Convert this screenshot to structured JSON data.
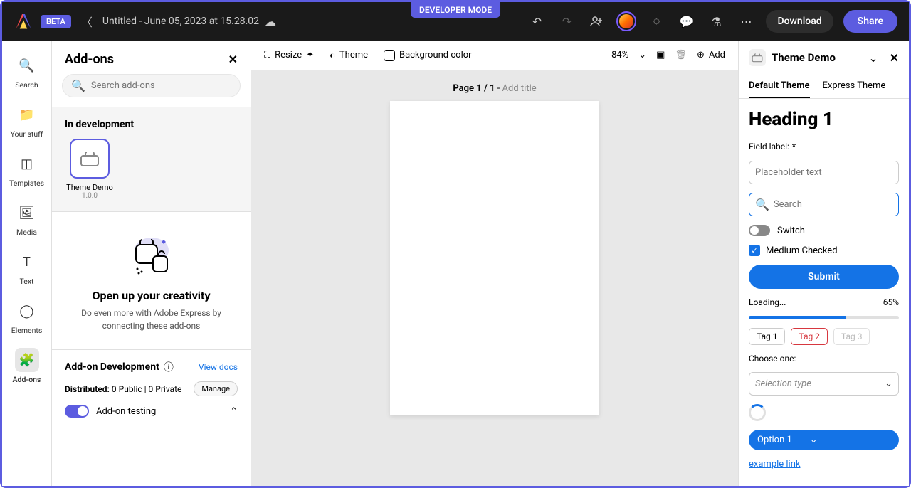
{
  "developer_mode": "DEVELOPER MODE",
  "topbar": {
    "beta": "BETA",
    "doc_title": "Untitled - June 05, 2023 at 15.28.02",
    "download": "Download",
    "share": "Share"
  },
  "rail": [
    {
      "label": "Search",
      "icon": "search-icon"
    },
    {
      "label": "Your stuff",
      "icon": "folder-icon"
    },
    {
      "label": "Templates",
      "icon": "templates-icon"
    },
    {
      "label": "Media",
      "icon": "media-icon"
    },
    {
      "label": "Text",
      "icon": "text-icon"
    },
    {
      "label": "Elements",
      "icon": "elements-icon"
    },
    {
      "label": "Add-ons",
      "icon": "addons-icon"
    }
  ],
  "addons_panel": {
    "title": "Add-ons",
    "search_placeholder": "Search add-ons",
    "in_dev": "In development",
    "tile": {
      "name": "Theme Demo",
      "version": "1.0.0"
    },
    "creativity": {
      "heading": "Open up your creativity",
      "text": "Do even more with Adobe Express by connecting these add-ons"
    },
    "dev": {
      "heading": "Add-on Development",
      "view_docs": "View docs",
      "distributed_label": "Distributed:",
      "distributed_value": "0 Public | 0 Private",
      "manage": "Manage",
      "testing": "Add-on testing"
    }
  },
  "canvas": {
    "resize": "Resize",
    "theme": "Theme",
    "bgcolor": "Background color",
    "zoom": "84%",
    "add": "Add",
    "page_prefix": "Page 1 / 1",
    "page_dash": " - ",
    "add_title": "Add title"
  },
  "right_panel": {
    "title": "Theme Demo",
    "tabs": [
      "Default Theme",
      "Express Theme"
    ],
    "heading": "Heading 1",
    "field_label": "Field label:",
    "required": "*",
    "placeholder_text": "Placeholder text",
    "search_placeholder": "Search",
    "switch_label": "Switch",
    "checkbox_label": "Medium Checked",
    "submit": "Submit",
    "loading": "Loading...",
    "loading_pct": "65%",
    "progress_pct": 65,
    "tags": [
      "Tag 1",
      "Tag 2",
      "Tag 3"
    ],
    "choose": "Choose one:",
    "selection_type": "Selection type",
    "option1": "Option 1",
    "example_link": "example link"
  }
}
